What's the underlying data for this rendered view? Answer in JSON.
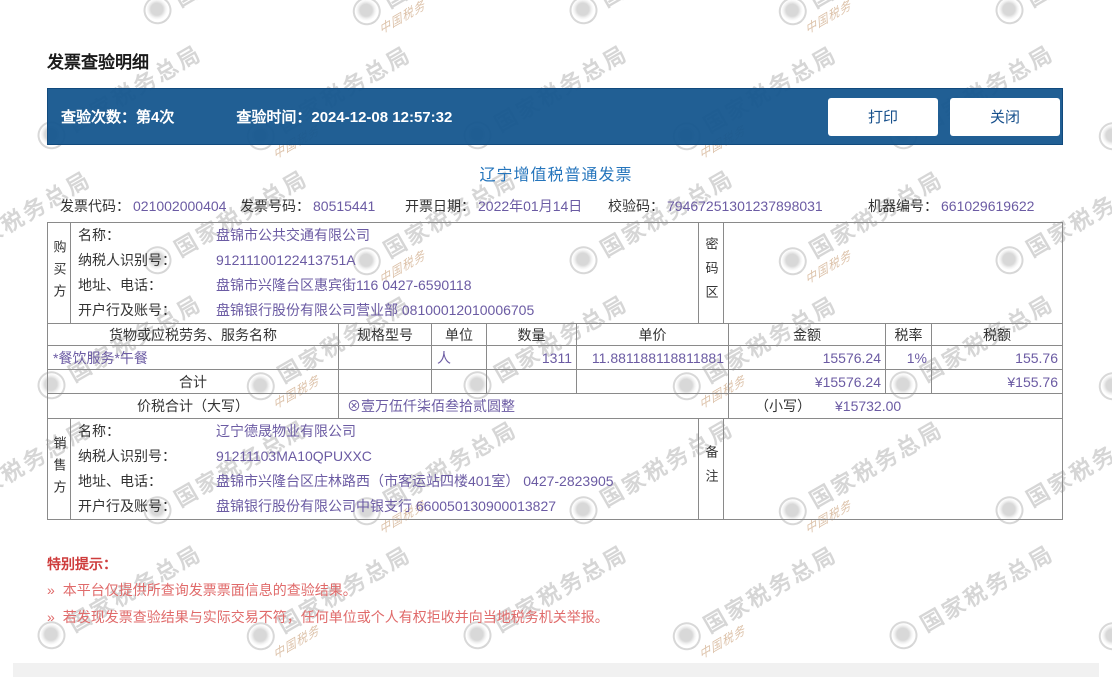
{
  "page": {
    "title": "发票查验明细"
  },
  "header_bar": {
    "check_count_label": "查验次数：",
    "check_count_value": "第4次",
    "check_time_label": "查验时间：",
    "check_time_value": "2024-12-08 12:57:32",
    "print_button": "打印",
    "close_button": "关闭"
  },
  "invoice": {
    "title": "辽宁增值税普通发票",
    "meta": [
      {
        "label": "发票代码：",
        "value": "021002000404"
      },
      {
        "label": "发票号码：",
        "value": "80515441"
      },
      {
        "label": "开票日期：",
        "value": "2022年01月14日"
      },
      {
        "label": "校验码：",
        "value": "79467251301237898031"
      },
      {
        "label": "机器编号：",
        "value": "661029619622"
      }
    ],
    "buyer": {
      "side_label": "购买方",
      "fields": [
        {
          "label": "名称：",
          "value": "盘锦市公共交通有限公司"
        },
        {
          "label": "纳税人识别号：",
          "value": "91211100122413751A"
        },
        {
          "label": "地址、电话：",
          "value": "盘锦市兴隆台区惠宾街116 0427-6590118"
        },
        {
          "label": "开户行及账号：",
          "value": "盘锦银行股份有限公司营业部 08100012010006705"
        }
      ]
    },
    "password_area_label": "密码区",
    "items_table": {
      "headers": [
        "货物或应税劳务、服务名称",
        "规格型号",
        "单位",
        "数量",
        "单价",
        "金额",
        "税率",
        "税额"
      ],
      "rows": [
        {
          "name": "*餐饮服务*午餐",
          "spec": "",
          "unit": "人",
          "qty": "1311",
          "price": "11.881188118811881",
          "amount": "15576.24",
          "rate": "1%",
          "tax": "155.76"
        }
      ],
      "total_label": "合计",
      "total_amount": "¥15576.24",
      "total_tax": "¥155.76"
    },
    "tax_total": {
      "label": "价税合计（大写）",
      "words": "⊗壹万伍仟柒佰叁拾贰圆整",
      "small_label": "（小写）",
      "small_value": "¥15732.00"
    },
    "seller": {
      "side_label": "销售方",
      "fields": [
        {
          "label": "名称：",
          "value": "辽宁德晟物业有限公司"
        },
        {
          "label": "纳税人识别号：",
          "value": "91211103MA10QPUXXC"
        },
        {
          "label": "地址、电话：",
          "value": "盘锦市兴隆台区庄林路西（市客运站四楼401室） 0427-2823905"
        },
        {
          "label": "开户行及账号：",
          "value": "盘锦银行股份有限公司中银支行 660050130900013827"
        }
      ]
    },
    "remark_label": "备注"
  },
  "notice": {
    "title": "特别提示：",
    "bullet": "»",
    "items": [
      "本平台仅提供所查询发票票面信息的查验结果。",
      "若发现发票查验结果与实际交易不符，任何单位或个人有权拒收并向当地税务机关举报。"
    ]
  },
  "watermark": {
    "text": "国家税务总局",
    "script_text": "中国税务"
  },
  "colors": {
    "accent_blue": "#15568E",
    "title_blue": "#2575BC",
    "value_purple": "#6B5BA3",
    "notice_red": "#CE3C3C",
    "border_gray": "#8A8A8A"
  }
}
